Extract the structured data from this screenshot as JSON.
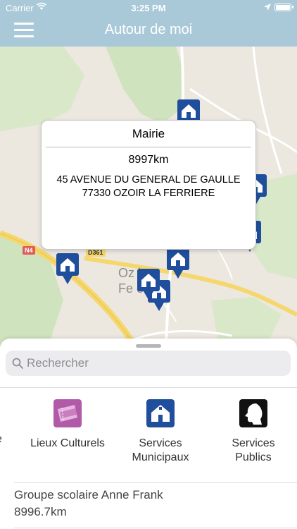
{
  "status_bar": {
    "carrier": "Carrier",
    "time": "3:25 PM"
  },
  "nav": {
    "title": "Autour de moi",
    "menu_icon": "hamburger-menu-icon"
  },
  "map": {
    "road_labels": [
      "N4",
      "D361"
    ],
    "town_label_line1": "Oz     la",
    "town_label_line2": "Fe       e"
  },
  "callout": {
    "title": "Mairie",
    "distance": "8997km",
    "address_line1": "45 AVENUE DU GENERAL DE GAULLE",
    "address_line2": "77330 OZOIR LA FERRIERE"
  },
  "search": {
    "placeholder": "Rechercher",
    "value": ""
  },
  "categories": {
    "partial_label": "e",
    "items": [
      {
        "label": "Lieux Culturels",
        "icon": "theater-tickets-icon",
        "color": "#b05aa8"
      },
      {
        "label": "Services\nMunicipaux",
        "icon": "town-hall-icon",
        "color": "#1f4e9c"
      },
      {
        "label": "Services\nPublics",
        "icon": "marianne-profile-icon",
        "color": "#111111"
      }
    ]
  },
  "list": [
    {
      "name": "Groupe scolaire Anne Frank",
      "distance": "8996.7km"
    }
  ],
  "colors": {
    "nav_bar": "#a9c9d9",
    "pin": "#1f4e9c"
  }
}
